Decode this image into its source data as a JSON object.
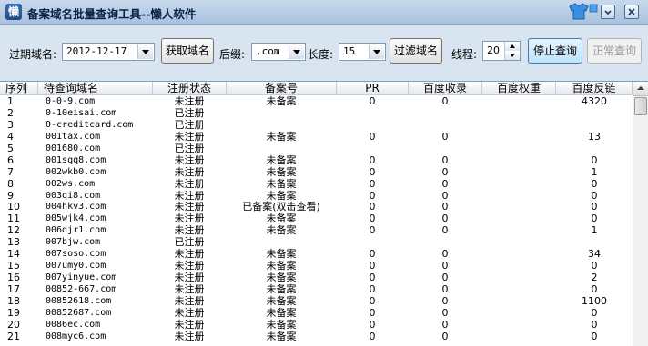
{
  "window": {
    "icon_char": "懒",
    "title": "备案域名批量查询工具--懒人软件",
    "theme_icon": "shirt-icon",
    "minimize_icon": "minimize-icon",
    "close_icon": "close-icon"
  },
  "toolbar": {
    "expire_label": "过期域名:",
    "expire_date": "2012-12-17",
    "fetch_button": "获取域名",
    "suffix_label": "后缀:",
    "suffix_value": ".com",
    "length_label": "长度:",
    "length_value": "15",
    "filter_button": "过滤域名",
    "threads_label": "线程:",
    "threads_value": "20",
    "stop_button": "停止查询",
    "normal_button": "正常查询"
  },
  "table": {
    "columns": [
      "序列",
      "待查询域名",
      "注册状态",
      "备案号",
      "PR",
      "百度收录",
      "百度权重",
      "百度反链"
    ],
    "rows": [
      [
        "1",
        "0-0-9.com",
        "未注册",
        "未备案",
        "0",
        "0",
        "",
        "4320"
      ],
      [
        "2",
        "0-10eisai.com",
        "已注册",
        "",
        "",
        "",
        "",
        ""
      ],
      [
        "3",
        "0-creditcard.com",
        "已注册",
        "",
        "",
        "",
        "",
        ""
      ],
      [
        "4",
        "001tax.com",
        "未注册",
        "未备案",
        "0",
        "0",
        "",
        "13"
      ],
      [
        "5",
        "001680.com",
        "已注册",
        "",
        "",
        "",
        "",
        ""
      ],
      [
        "6",
        "001sqq8.com",
        "未注册",
        "未备案",
        "0",
        "0",
        "",
        "0"
      ],
      [
        "7",
        "002wkb0.com",
        "未注册",
        "未备案",
        "0",
        "0",
        "",
        "1"
      ],
      [
        "8",
        "002ws.com",
        "未注册",
        "未备案",
        "0",
        "0",
        "",
        "0"
      ],
      [
        "9",
        "003qi8.com",
        "未注册",
        "未备案",
        "0",
        "0",
        "",
        "0"
      ],
      [
        "10",
        "004hkv3.com",
        "未注册",
        "已备案(双击查看)",
        "0",
        "0",
        "",
        "0"
      ],
      [
        "11",
        "005wjk4.com",
        "未注册",
        "未备案",
        "0",
        "0",
        "",
        "0"
      ],
      [
        "12",
        "006djr1.com",
        "未注册",
        "未备案",
        "0",
        "0",
        "",
        "1"
      ],
      [
        "13",
        "007bjw.com",
        "已注册",
        "",
        "",
        "",
        "",
        ""
      ],
      [
        "14",
        "007soso.com",
        "未注册",
        "未备案",
        "0",
        "0",
        "",
        "34"
      ],
      [
        "15",
        "007umy0.com",
        "未注册",
        "未备案",
        "0",
        "0",
        "",
        "0"
      ],
      [
        "16",
        "007yinyue.com",
        "未注册",
        "未备案",
        "0",
        "0",
        "",
        "2"
      ],
      [
        "17",
        "00852-667.com",
        "未注册",
        "未备案",
        "0",
        "0",
        "",
        "0"
      ],
      [
        "18",
        "00852618.com",
        "未注册",
        "未备案",
        "0",
        "0",
        "",
        "1100"
      ],
      [
        "19",
        "00852687.com",
        "未注册",
        "未备案",
        "0",
        "0",
        "",
        "0"
      ],
      [
        "20",
        "0086ec.com",
        "未注册",
        "未备案",
        "0",
        "0",
        "",
        "0"
      ],
      [
        "21",
        "008myc6.com",
        "未注册",
        "未备案",
        "0",
        "0",
        "",
        "0"
      ]
    ]
  }
}
